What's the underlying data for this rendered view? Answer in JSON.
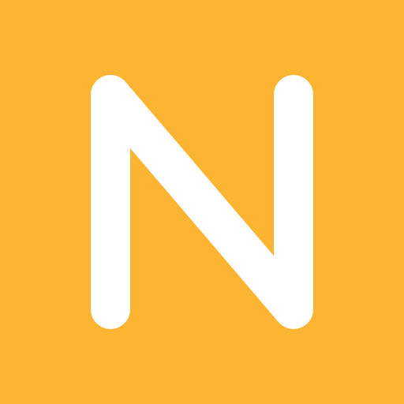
{
  "logo": {
    "letter": "N",
    "icon": "letter-n-logo-icon"
  },
  "colors": {
    "background": "#FDB433",
    "foreground": "#FFFFFF"
  }
}
